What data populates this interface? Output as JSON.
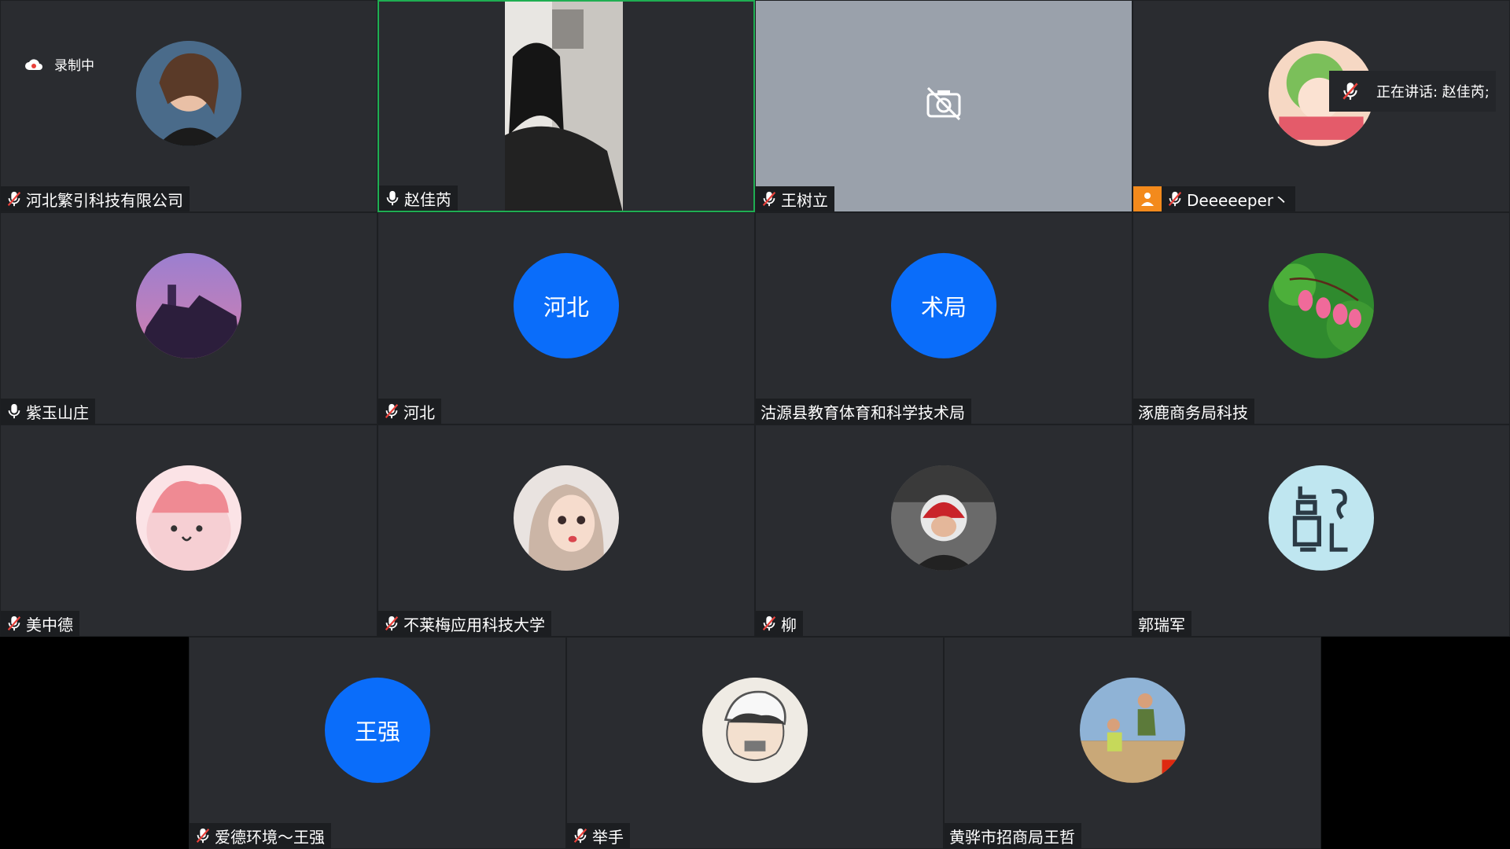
{
  "recording": {
    "label": "录制中"
  },
  "active_speaker": {
    "label": "正在讲话: 赵佳芮;"
  },
  "participants": [
    {
      "name": "河北繁引科技有限公司",
      "mic": "muted",
      "avatar": "photo-woman"
    },
    {
      "name": "赵佳芮",
      "mic": "on",
      "video": "on"
    },
    {
      "name": "王树立",
      "mic": "muted",
      "video": "camera-off"
    },
    {
      "name": "Deeeeeper丶",
      "mic": "muted",
      "avatar": "cartoon-girl",
      "badge": "orange-user-badge"
    },
    {
      "name": "紫玉山庄",
      "mic": "on",
      "avatar": "pagoda-sunset"
    },
    {
      "name": "河北",
      "mic": "muted",
      "initials": "河北"
    },
    {
      "name": "沽源县教育体育和科学技术局",
      "mic": "none",
      "initials": "术局"
    },
    {
      "name": "涿鹿商务局科技",
      "mic": "none",
      "avatar": "pink-flowers"
    },
    {
      "name": "美中德",
      "mic": "muted",
      "avatar": "pink-blob"
    },
    {
      "name": "不莱梅应用科技大学",
      "mic": "muted",
      "avatar": "doll-girl"
    },
    {
      "name": "柳",
      "mic": "muted",
      "avatar": "helmet-kid"
    },
    {
      "name": "郭瑞军",
      "mic": "none",
      "avatar": "calligraphy"
    },
    {
      "name": "爱德环境～王强",
      "mic": "muted",
      "initials": "王强"
    },
    {
      "name": "举手",
      "mic": "muted",
      "avatar": "sketch-boy"
    },
    {
      "name": "黄骅市招商局王哲",
      "mic": "none",
      "avatar": "jumping-man"
    }
  ],
  "colors": {
    "tile": "#2a2c30",
    "speaking_border": "#1fae52",
    "initials_bg": "#0a6dfa",
    "badge": "#f38a1c"
  }
}
